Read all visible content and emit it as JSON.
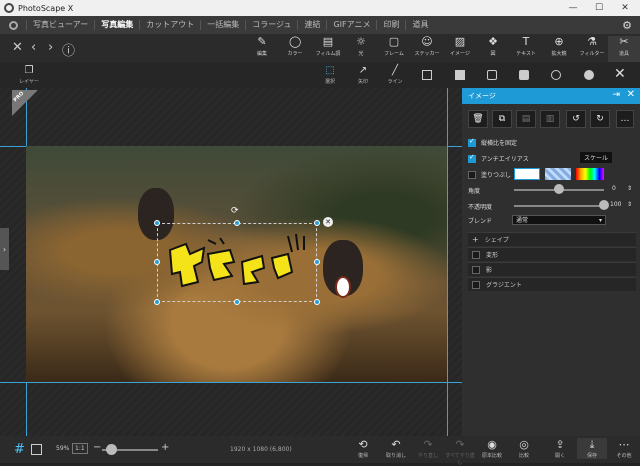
{
  "window": {
    "title": "PhotoScape X",
    "minimize": "—",
    "maximize": "☐",
    "close": "✕"
  },
  "menu": {
    "tabs": [
      "写真ビューアー",
      "写真編集",
      "カットアウト",
      "一括編集",
      "コラージュ",
      "連結",
      "GIFアニメ",
      "印刷",
      "道具"
    ],
    "active": "写真編集"
  },
  "toolbar": {
    "nav": {
      "close": "✕",
      "prev": "‹",
      "next": "›",
      "info": "ⓘ"
    },
    "buttons": [
      {
        "label": "編集",
        "icon": "✎"
      },
      {
        "label": "カラー",
        "icon": "◯"
      },
      {
        "label": "フィルム調",
        "icon": "▤"
      },
      {
        "label": "光",
        "icon": "☼"
      },
      {
        "label": "フレーム",
        "icon": "▢"
      },
      {
        "label": "ステッカー",
        "icon": "☺"
      },
      {
        "label": "イメージ",
        "icon": "▨"
      },
      {
        "label": "図",
        "icon": "❖"
      },
      {
        "label": "テキスト",
        "icon": "T"
      },
      {
        "label": "拡大鏡",
        "icon": "⊕"
      },
      {
        "label": "フィルター",
        "icon": "⚗"
      },
      {
        "label": "道具",
        "icon": "✂"
      }
    ]
  },
  "subbar": {
    "layer": "レイヤー",
    "select": "選択",
    "arrow": "矢印",
    "line": "ライン"
  },
  "canvas": {
    "pro_badge": "PRO"
  },
  "panel": {
    "title": "イメージ",
    "keep_ratio": "縦横比を固定",
    "antialias": "アンチエイリアス",
    "scale": "スケール",
    "fill": "塗りつぶし",
    "angle_label": "角度",
    "angle_value": "0",
    "opacity_label": "不透明度",
    "opacity_value": "100",
    "blend_label": "ブレンド",
    "blend_value": "通常",
    "sections": [
      "シェイプ",
      "変形",
      "影",
      "グラジエント"
    ],
    "angle_level": 0.5,
    "opacity_level": 1.0
  },
  "bottombar": {
    "zoom_label": "59%",
    "zoom_btn": "1:1",
    "zoom_minus": "−",
    "zoom_plus": "+",
    "dimensions": "1920 x 1080 (6,800)",
    "buttons": [
      {
        "label": "復帰",
        "icon": "⟲"
      },
      {
        "label": "取り消し",
        "icon": "↶"
      },
      {
        "label": "やり直し",
        "icon": "↷"
      },
      {
        "label": "すべてやり直し",
        "icon": "↷"
      },
      {
        "label": "原本比較",
        "icon": "◉"
      },
      {
        "label": "比較",
        "icon": "◎"
      },
      {
        "label": "開く",
        "icon": "⇪"
      },
      {
        "label": "保存",
        "icon": "⤓"
      },
      {
        "label": "その他",
        "icon": "⋯"
      }
    ]
  },
  "colors": {
    "accent": "#1e9bd7",
    "stamp": "#f5e31a"
  }
}
